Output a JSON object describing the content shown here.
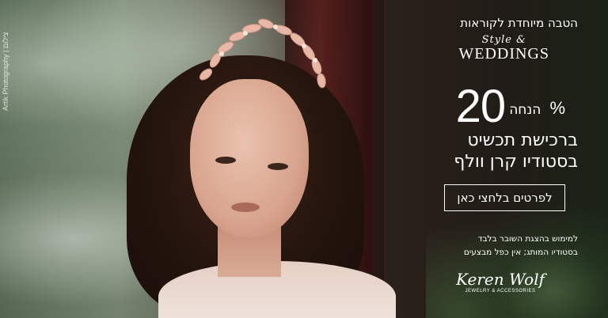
{
  "photo_credit": "Artik Photography | צילום",
  "promo_heading": "הטבה מיוחדת לקוראות",
  "brand_logo": {
    "script": "Style &",
    "main": "WEDDINGS"
  },
  "discount": {
    "word": "הנחה",
    "number": "20",
    "percent": "%"
  },
  "headline": {
    "line1": "ברכישת תכשיט",
    "line2": "בסטודיו קרן וולף"
  },
  "cta_label": "לפרטים בלחצי כאן",
  "fine_print": {
    "line1": "למימוש בהצגת השובר בלבד",
    "line2": "בסטודיו המותג; אין כפל מבצעים"
  },
  "studio_logo": {
    "script": "Keren Wolf",
    "sub": "JEWELRY & ACCESSORIES"
  },
  "colors": {
    "text": "#ffffff",
    "curtain": "#5a1d1a",
    "hair": "#24140e"
  }
}
